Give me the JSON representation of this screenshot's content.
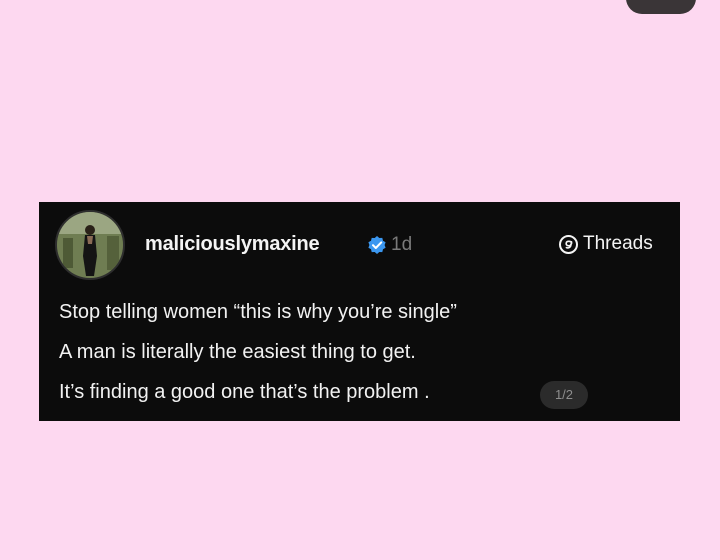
{
  "post": {
    "username": "maliciouslymaxine",
    "time_ago": "1d",
    "platform": "Threads",
    "lines": [
      "Stop telling women “this is why you’re single”",
      "A man is literally the easiest thing to get.",
      "It’s finding a good one that’s the problem ."
    ],
    "page_indicator": "1/2"
  },
  "colors": {
    "page_background": "#fdd8f0",
    "card_background": "#0c0c0c",
    "verified_badge": "#3b97f0",
    "secondary_text": "#7a7a7a"
  },
  "icons": {
    "verified": "verified-badge-icon",
    "platform": "threads-logo-icon"
  }
}
